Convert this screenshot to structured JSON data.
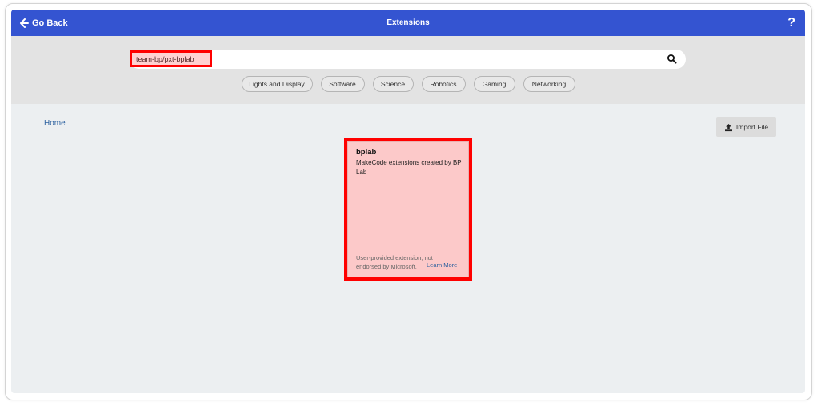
{
  "header": {
    "back_label": "Go Back",
    "title": "Extensions",
    "help_label": "?"
  },
  "search": {
    "value": "team-bp/pxt-bplab",
    "placeholder": ""
  },
  "categories": [
    "Lights and Display",
    "Software",
    "Science",
    "Robotics",
    "Gaming",
    "Networking"
  ],
  "breadcrumb": {
    "home": "Home"
  },
  "import_button": {
    "label": "Import File"
  },
  "results": [
    {
      "name": "bplab",
      "description": "MakeCode extensions created by BP Lab",
      "note": "User-provided extension, not endorsed by Microsoft.",
      "learn_more": "Learn More"
    }
  ],
  "colors": {
    "header": "#3454d1",
    "highlight": "#ff0000",
    "card_fill": "#fcc9c9",
    "link": "#2a5f9e"
  },
  "icons": {
    "back": "arrow-left-icon",
    "search": "search-icon",
    "import": "upload-icon",
    "help": "help-icon"
  }
}
